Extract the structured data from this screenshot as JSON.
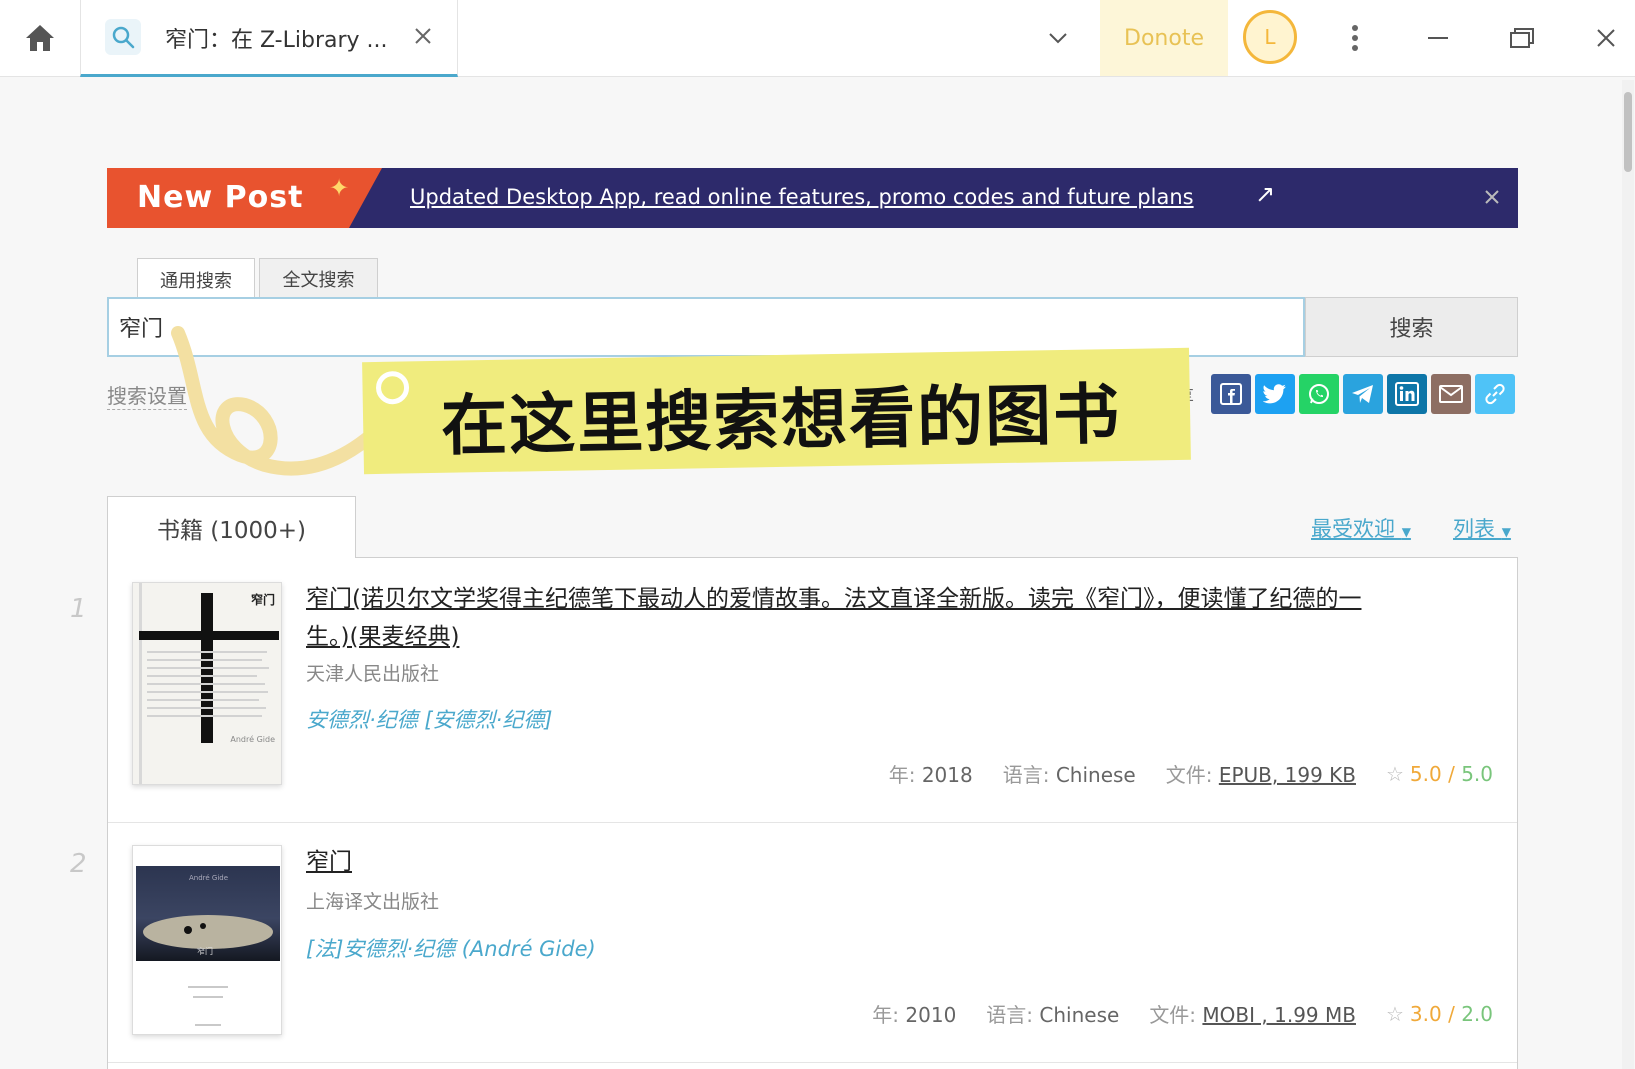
{
  "titlebar": {
    "tab_title": "窄门：在 Z-Library ...",
    "donate_label": "Donote",
    "avatar_letter": "L"
  },
  "banner": {
    "badge": "New Post",
    "link_text": "Updated Desktop App, read online features, promo codes and future plans"
  },
  "search": {
    "tabs": [
      "通用搜索",
      "全文搜索"
    ],
    "query": "窄门",
    "button_label": "搜索",
    "settings_label": "搜索设置",
    "share_partial": "享"
  },
  "share_icons": [
    {
      "name": "facebook-icon",
      "color": "#3b5998"
    },
    {
      "name": "twitter-icon",
      "color": "#1da1f2"
    },
    {
      "name": "whatsapp-icon",
      "color": "#25d366"
    },
    {
      "name": "telegram-icon",
      "color": "#2aa3de"
    },
    {
      "name": "linkedin-icon",
      "color": "#0e76a8"
    },
    {
      "name": "email-icon",
      "color": "#8d6e63"
    },
    {
      "name": "link-icon",
      "color": "#4fc3f7"
    }
  ],
  "annotation": {
    "text": "在这里搜索想看的图书"
  },
  "results": {
    "tab_label": "书籍 (1000+)",
    "sort_label": "最受欢迎",
    "view_label": "列表",
    "items": [
      {
        "rank": "1",
        "title": "窄门(诺贝尔文学奖得主纪德笔下最动人的爱情故事。法文直译全新版。读完《窄门》，便读懂了纪德的一生。)(果麦经典)",
        "publisher": "天津人民出版社",
        "author": "安德烈·纪德 [安德烈·纪德]",
        "year_label": "年:",
        "year": "2018",
        "lang_label": "语言:",
        "lang": "Chinese",
        "file_label": "文件:",
        "file": "EPUB, 199 KB",
        "rating": "5.0",
        "quality": "5.0",
        "cover_title": "窄门",
        "cover_author": "André Gide"
      },
      {
        "rank": "2",
        "title": "窄门",
        "publisher": "上海译文出版社",
        "author": "[法]安德烈·纪德 (André Gide)",
        "year_label": "年:",
        "year": "2010",
        "lang_label": "语言:",
        "lang": "Chinese",
        "file_label": "文件:",
        "file": "MOBI , 1.99 MB",
        "rating": "3.0",
        "quality": "2.0",
        "cover_title": "窄门",
        "cover_author": "André Gide"
      }
    ]
  }
}
